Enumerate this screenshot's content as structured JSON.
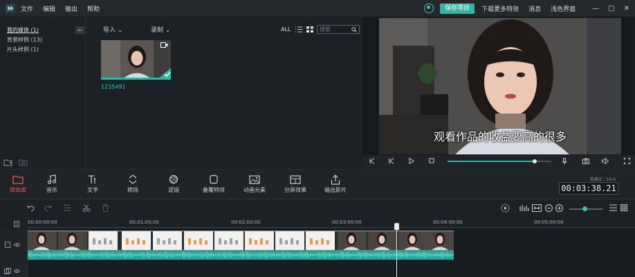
{
  "app": {
    "menu": [
      "文件",
      "编辑",
      "输出",
      "帮助"
    ],
    "save_project": "保存项目",
    "download_effects": "下载更多特效",
    "messages": "消息",
    "theme": "浅色界面",
    "window_controls": [
      "—",
      "□",
      "✕"
    ]
  },
  "library": {
    "sidebar": [
      {
        "label": "我的媒体 (1)",
        "active": true
      },
      {
        "label": "背景样例 (13)",
        "active": false
      },
      {
        "label": "片头样例 (1)",
        "active": false
      }
    ],
    "import_label": "导入",
    "record_label": "录制",
    "all_label": "ALL",
    "search_placeholder": "搜索",
    "media": [
      {
        "name": "1235491",
        "selected": true
      }
    ]
  },
  "preview": {
    "subtitle": "观看作品的收益要高的很多",
    "progress": 0.84
  },
  "modules": [
    {
      "label": "媒体库",
      "icon": "folder-icon",
      "active": true
    },
    {
      "label": "音乐",
      "icon": "music-note-icon",
      "active": false
    },
    {
      "label": "文字",
      "icon": "text-icon",
      "active": false
    },
    {
      "label": "转场",
      "icon": "transition-icon",
      "active": false
    },
    {
      "label": "滤镜",
      "icon": "filter-icon",
      "active": false
    },
    {
      "label": "叠覆特效",
      "icon": "overlay-icon",
      "active": false
    },
    {
      "label": "动画元素",
      "icon": "image-element-icon",
      "active": false
    },
    {
      "label": "分屏效果",
      "icon": "split-screen-icon",
      "active": false
    },
    {
      "label": "输出影片",
      "icon": "export-icon",
      "active": false
    }
  ],
  "player": {
    "aspect_ratio": "宽高比 : 16:9",
    "timecode": "00:03:38.21"
  },
  "timeline": {
    "ruler_labels": [
      "00:00:00:00",
      "00:01:00:00",
      "00:02:00:00",
      "00:03:00:00",
      "00:04:00:00",
      "00:05:00:00"
    ],
    "zoom_level": 0.45
  },
  "colors": {
    "accent": "#34b5a4",
    "active_module": "#e4574e",
    "audio_track": "#2aa197"
  }
}
